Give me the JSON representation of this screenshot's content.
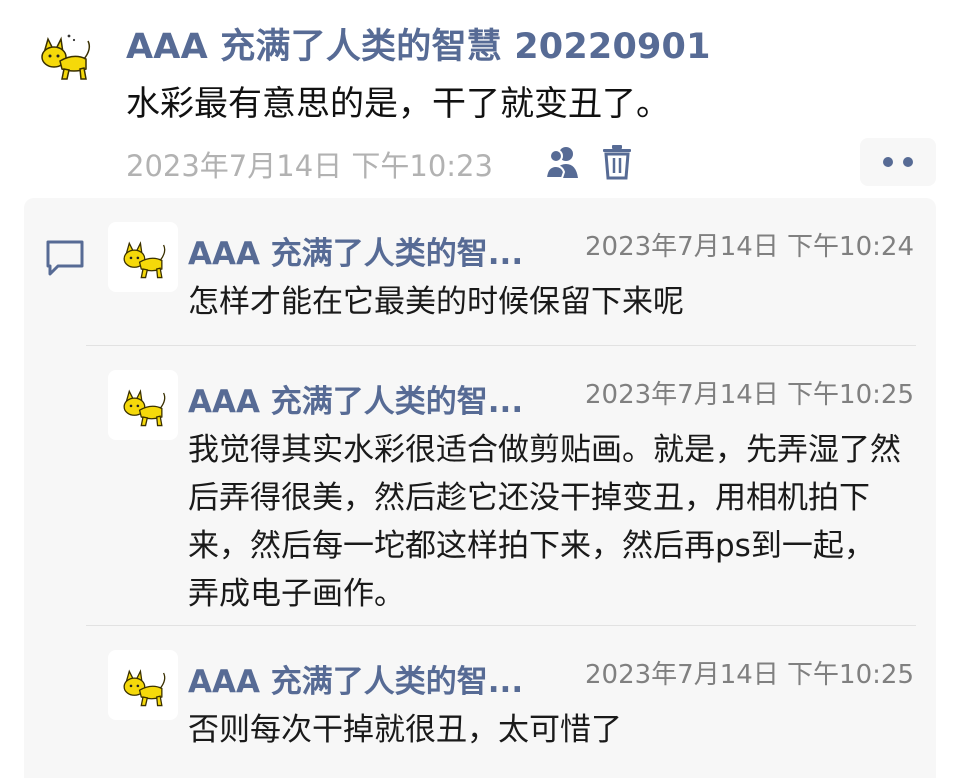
{
  "post": {
    "author": "AAA 充满了人类的智慧 20220901",
    "text": "水彩最有意思的是，干了就变丑了。",
    "time": "2023年7月14日 下午10:23",
    "icons": {
      "avatar": "yellow-cat-avatar",
      "visibility": "friends-icon",
      "delete": "trash-icon",
      "more": "more-dots"
    },
    "colors": {
      "name": "#576b95",
      "time": "#b2b2b2",
      "comments_bg": "#f7f7f7"
    }
  },
  "comments": [
    {
      "author": "AAA 充满了人类的智...",
      "time": "2023年7月14日 下午10:24",
      "text": "怎样才能在它最美的时候保留下来呢"
    },
    {
      "author": "AAA 充满了人类的智...",
      "time": "2023年7月14日 下午10:25",
      "text": "我觉得其实水彩很适合做剪贴画。就是，先弄湿了然后弄得很美，然后趁它还没干掉变丑，用相机拍下来，然后每一坨都这样拍下来，然后再ps到一起，弄成电子画作。"
    },
    {
      "author": "AAA 充满了人类的智...",
      "time": "2023年7月14日 下午10:25",
      "text": "否则每次干掉就很丑，太可惜了"
    }
  ]
}
